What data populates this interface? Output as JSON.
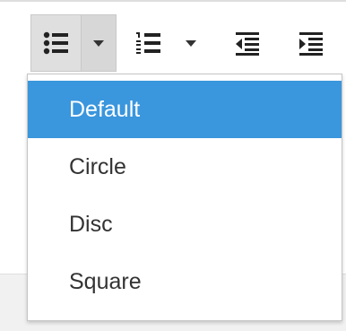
{
  "toolbar": {
    "bullet_list_icon": "bullet-list-icon",
    "numbered_list_icon": "numbered-list-icon",
    "outdent_icon": "outdent-icon",
    "indent_icon": "indent-icon",
    "caret_icon": "chevron-down-icon"
  },
  "dropdown": {
    "items": [
      {
        "label": "Default",
        "active": true
      },
      {
        "label": "Circle",
        "active": false
      },
      {
        "label": "Disc",
        "active": false
      },
      {
        "label": "Square",
        "active": false
      }
    ]
  },
  "colors": {
    "active_bg": "#3a96dd",
    "active_text": "#ffffff",
    "text": "#333333",
    "toolbar_pressed": "#dfdfdf"
  }
}
